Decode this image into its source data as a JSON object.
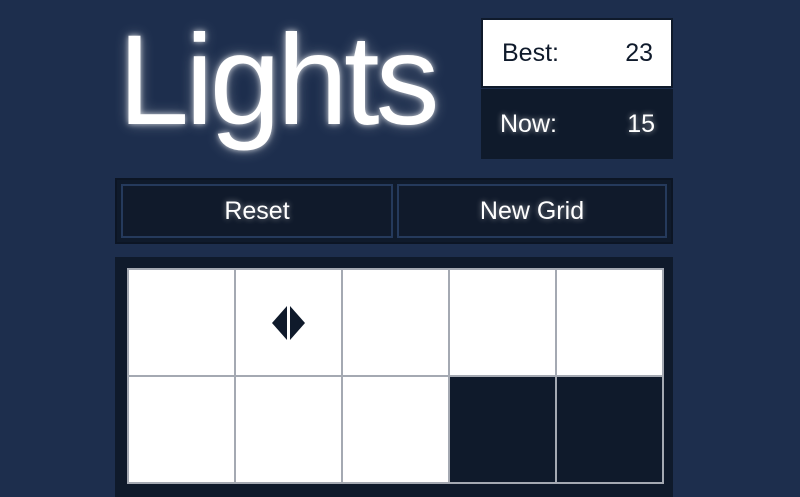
{
  "title": "Lights",
  "scores": {
    "best_label": "Best:",
    "best_value": "23",
    "now_label": "Now:",
    "now_value": "15"
  },
  "controls": {
    "reset_label": "Reset",
    "new_grid_label": "New Grid"
  },
  "grid": {
    "columns": 5,
    "cursor": {
      "row": 0,
      "col": 1,
      "icon": "left-right-arrows-icon"
    },
    "rows": [
      [
        "on",
        "on",
        "on",
        "on",
        "on"
      ],
      [
        "on",
        "on",
        "on",
        "off",
        "off"
      ]
    ]
  },
  "colors": {
    "background": "#1d2e4d",
    "dark": "#0f1a2b",
    "light": "#ffffff",
    "grid_line": "#a4a9b2"
  }
}
